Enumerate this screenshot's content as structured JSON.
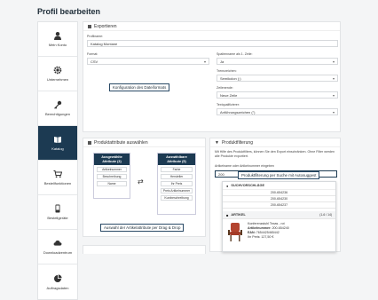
{
  "page": {
    "title": "Profil bearbeiten"
  },
  "sidebar": {
    "items": [
      {
        "label": "Mein Konto",
        "icon": "user-icon"
      },
      {
        "label": "Unternehmen",
        "icon": "gear-icon"
      },
      {
        "label": "Berechtigungen",
        "icon": "key-icon"
      },
      {
        "label": "Katalog",
        "icon": "book-icon",
        "active": true
      },
      {
        "label": "Bestellfunktionen",
        "icon": "cart-icon"
      },
      {
        "label": "Bestellgeräte",
        "icon": "device-icon"
      },
      {
        "label": "Downloadzentrum",
        "icon": "cloud-icon"
      },
      {
        "label": "Auftragsdaten",
        "icon": "pie-chart-icon"
      }
    ]
  },
  "export": {
    "heading": "Exportieren",
    "profile_label": "Profilname:",
    "profile_value": "Katalog Montane",
    "format_label": "Format:",
    "format_value": "CSV",
    "column_names_label": "Spaltenname als 1. Zeile:",
    "column_names_value": "Ja",
    "separator_label": "Trennzeichen:",
    "separator_value": "Semikolon (;)",
    "line_end_label": "Zeilenende:",
    "line_end_value": "Neue Zeile",
    "quote_label": "Textqualifizierer:",
    "quote_value": "Anführungszeichen (\")"
  },
  "callouts": {
    "config": "Konfiguration des Dateiformats",
    "dragdrop": "Auswahl der Artikelattribute per Drag & Drop",
    "filter": "Produktfilterung per Suche mit Autosuggest"
  },
  "attributes": {
    "heading": "Produktattribute auswählen",
    "selected_title": "Ausgewählte Attribute (3)",
    "selected": [
      "Artikelnummer",
      "Beschreibung",
      "Name"
    ],
    "available_title": "Auswählbare Attribute (5)",
    "available": [
      "Farbe",
      "Hersteller",
      "Ihr Preis",
      "Preis Artikelnummer",
      "Kurzbeschreibung"
    ]
  },
  "filter": {
    "heading": "Produktfilterung",
    "description": "Mit Hilfe des Produktfilters, können Sie den Export einschränken. Ohne Filter werden alle Produkte exportiert.",
    "input_label": "Artikelname oder Artikelnummer eingeben",
    "input_value": "200",
    "suggestions_heading": "SUCHVORSCHLÄGE",
    "suggestions": [
      "200-654236",
      "200-654230",
      "200-654237"
    ],
    "articles_heading": "ARTIKEL",
    "articles_count": "(1-6 / 14)",
    "article": {
      "name": "Konferenzstuhl Texas - rot",
      "number_label": "Artikelnummer:",
      "number_value": "200-654240",
      "ean_label": "EAN:",
      "ean_value": "7654425465442",
      "price_label": "Ihr Preis:",
      "price_value": "127,50 €"
    }
  },
  "colors": {
    "accent": "#1c3a52",
    "callout_border": "#2a4a66"
  }
}
